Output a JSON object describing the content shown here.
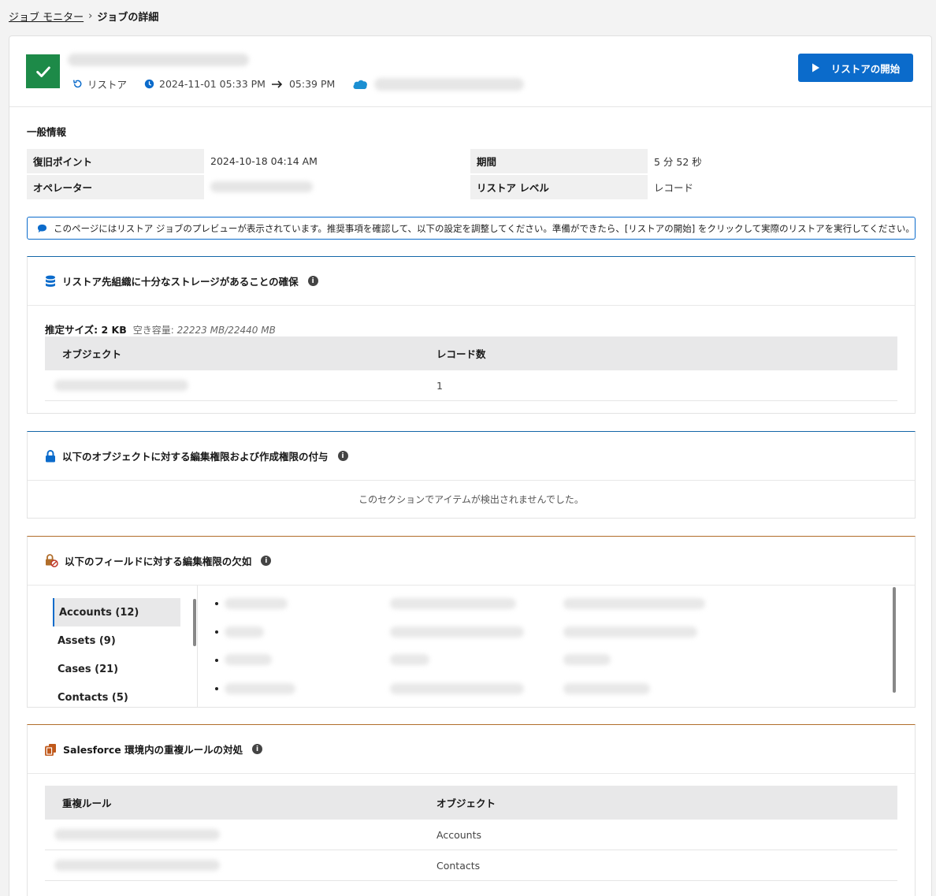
{
  "breadcrumb": {
    "parent": "ジョブ モニター",
    "current": "ジョブの詳細"
  },
  "header": {
    "type_label": "リストア",
    "time_start": "2024-11-01 05:33 PM",
    "time_end": "05:39 PM",
    "start_button": "リストアの開始"
  },
  "general": {
    "title": "一般情報",
    "recovery_point_label": "復旧ポイント",
    "recovery_point_value": "2024-10-18 04:14 AM",
    "operator_label": "オペレーター",
    "period_label": "期間",
    "period_value": "5 分 52 秒",
    "restore_level_label": "リストア レベル",
    "restore_level_value": "レコード"
  },
  "notice": "このページにはリストア ジョブのプレビューが表示されています。推奨事項を確認して、以下の設定を調整してください。準備ができたら、[リストアの開始] をクリックして実際のリストアを実行してください。",
  "storage": {
    "title": "リストア先組織に十分なストレージがあることの確保",
    "estimate_label": "推定サイズ: 2 KB",
    "free_label": "空き容量:",
    "free_value": "22223 MB/22440 MB",
    "col_object": "オブジェクト",
    "col_records": "レコード数",
    "row_count": "1"
  },
  "permissions": {
    "title": "以下のオブジェクトに対する編集権限および作成権限の付与",
    "empty": "このセクションでアイテムが検出されませんでした。"
  },
  "fields": {
    "title": "以下のフィールドに対する編集権限の欠如",
    "objects": [
      "Accounts (12)",
      "Assets (9)",
      "Cases (21)",
      "Contacts (5)"
    ]
  },
  "duplicates": {
    "title": "Salesforce 環境内の重複ルールの対処",
    "col_rule": "重複ルール",
    "col_object": "オブジェクト",
    "rows": [
      "Accounts",
      "Contacts"
    ]
  },
  "colors": {
    "accent": "#0b6bcb",
    "success": "#1d8a48",
    "warning": "#b06d2a"
  }
}
